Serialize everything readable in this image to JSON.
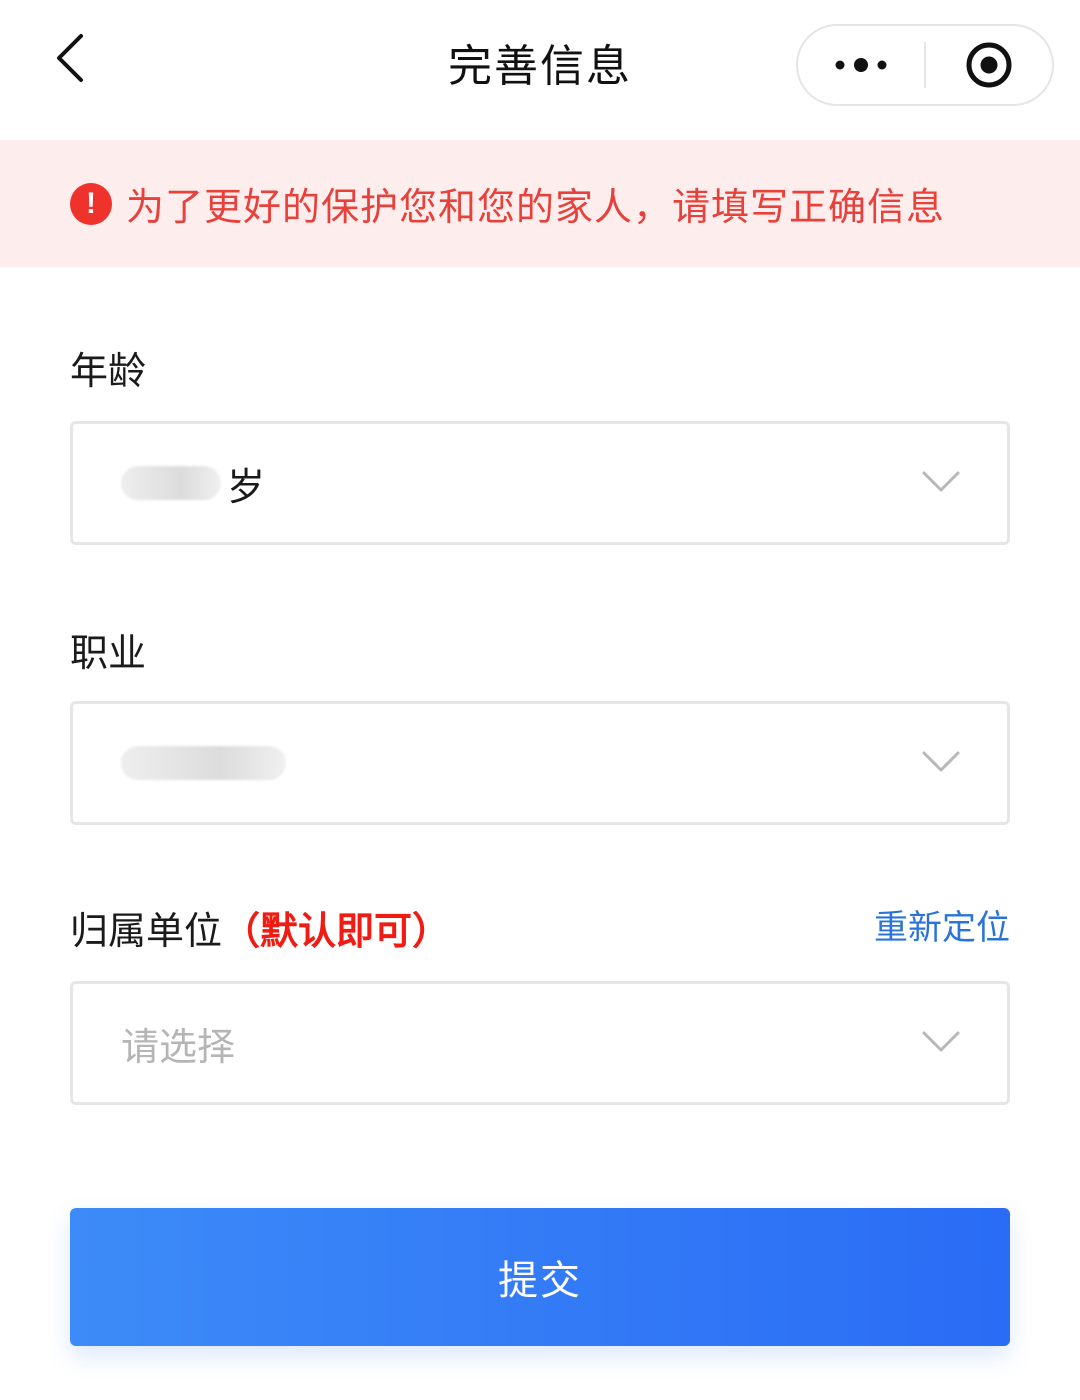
{
  "header": {
    "title": "完善信息"
  },
  "notice": {
    "text": "为了更好的保护您和您的家人，请填写正确信息",
    "icon": "exclamation-circle-icon",
    "icon_glyph": "!"
  },
  "form": {
    "age": {
      "label": "年龄",
      "suffix": "岁"
    },
    "occupation": {
      "label": "职业"
    },
    "unit": {
      "label": "归属单位",
      "hint": "（默认即可）",
      "relocate_label": "重新定位",
      "placeholder": "请选择"
    }
  },
  "submit_label": "提交",
  "colors": {
    "accent_blue": "#2a6cf5",
    "link_blue": "#2a74d8",
    "warning_red": "#e8413b",
    "notice_bg": "#fdeeed"
  }
}
